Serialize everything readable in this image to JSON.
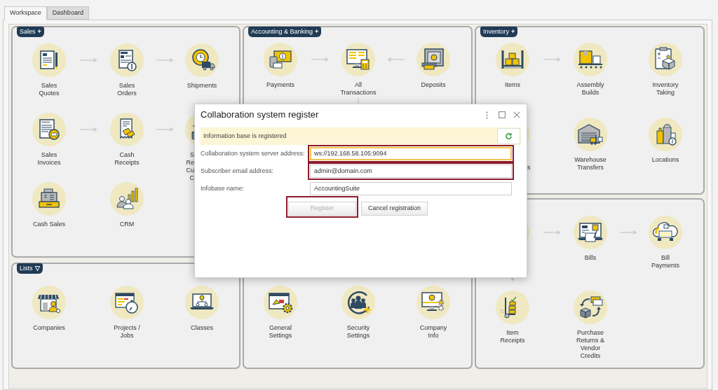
{
  "tabs": [
    {
      "label": "Workspace",
      "selected": true
    },
    {
      "label": "Dashboard",
      "selected": false
    }
  ],
  "columns": [
    {
      "panels": [
        {
          "title": "Sales",
          "toggle": "+",
          "rows": [
            {
              "cells": [
                {
                  "kind": "item",
                  "label": "Sales\nQuotes"
                },
                {
                  "kind": "arrow"
                },
                {
                  "kind": "item",
                  "label": "Sales\nOrders"
                },
                {
                  "kind": "arrow"
                },
                {
                  "kind": "item",
                  "label": "Shipments"
                }
              ]
            },
            {
              "cells": [
                {
                  "kind": "item",
                  "label": "Sales\nInvoices"
                },
                {
                  "kind": "arrow"
                },
                {
                  "kind": "item",
                  "label": "Cash\nReceipts"
                },
                {
                  "kind": "arrow"
                },
                {
                  "kind": "item",
                  "label": "S\nRe\nCu\nC",
                  "covered": true
                }
              ]
            },
            {
              "cells": [
                {
                  "kind": "item",
                  "label": "Cash Sales"
                },
                {
                  "kind": "gap"
                },
                {
                  "kind": "item",
                  "label": "CRM"
                }
              ]
            }
          ]
        },
        {
          "title": "Lists",
          "toggle": "▽",
          "rows": [
            {
              "cells": [
                {
                  "kind": "item",
                  "label": "Companies"
                },
                {
                  "kind": "gap"
                },
                {
                  "kind": "item",
                  "label": "Projects /\nJobs"
                },
                {
                  "kind": "gap"
                },
                {
                  "kind": "item",
                  "label": "Classes"
                }
              ]
            }
          ]
        }
      ]
    },
    {
      "panels": [
        {
          "title": "Accounting & Banking",
          "toggle": "+",
          "rows": [
            {
              "cells": [
                {
                  "kind": "item",
                  "label": "Payments"
                },
                {
                  "kind": "arrow"
                },
                {
                  "kind": "item",
                  "label": "All\nTransactions"
                },
                {
                  "kind": "backarrow"
                },
                {
                  "kind": "item",
                  "label": "Deposits"
                }
              ]
            },
            {
              "cells": [
                {
                  "kind": "gap"
                },
                {
                  "kind": "gap"
                },
                {
                  "kind": "downarrow"
                }
              ]
            }
          ]
        },
        {
          "rows": [
            {
              "cells": [
                {
                  "kind": "item",
                  "label": "General\nSettings"
                },
                {
                  "kind": "gap"
                },
                {
                  "kind": "item",
                  "label": "Security\nSettings"
                },
                {
                  "kind": "gap"
                },
                {
                  "kind": "item",
                  "label": "Company\nInfo"
                }
              ]
            }
          ]
        }
      ]
    },
    {
      "panels": [
        {
          "title": "Inventory",
          "toggle": "+",
          "rows": [
            {
              "cells": [
                {
                  "kind": "item",
                  "label": "Items"
                },
                {
                  "kind": "arrow"
                },
                {
                  "kind": "item",
                  "label": "Assembly\nBuilds"
                },
                {
                  "kind": "gap"
                },
                {
                  "kind": "item",
                  "label": "Inventory\nTaking"
                }
              ]
            },
            {
              "cells": [
                {
                  "kind": "item",
                  "label": "s",
                  "covered": true
                },
                {
                  "kind": "gap"
                },
                {
                  "kind": "item",
                  "label": "Warehouse\nTransfers"
                },
                {
                  "kind": "gap"
                },
                {
                  "kind": "item",
                  "label": "Locations"
                }
              ]
            }
          ]
        },
        {
          "rows": [
            {
              "cells": [
                {
                  "kind": "item",
                  "covered": true
                },
                {
                  "kind": "arrow"
                },
                {
                  "kind": "item",
                  "label": "Bills"
                },
                {
                  "kind": "arrow"
                },
                {
                  "kind": "item",
                  "label": "Bill\nPayments"
                }
              ]
            },
            {
              "cells": [
                {
                  "kind": "downarrow"
                }
              ]
            },
            {
              "cells": [
                {
                  "kind": "item",
                  "label": "Item\nReceipts"
                },
                {
                  "kind": "gap"
                },
                {
                  "kind": "item",
                  "label": "Purchase\nReturns &\nVendor\nCredits"
                }
              ]
            }
          ]
        }
      ]
    }
  ],
  "dialog": {
    "title": "Collaboration system register",
    "status": {
      "message": "Information base is registered"
    },
    "fields": [
      {
        "label": "Collaboration system server address:",
        "value": "ws://192.168.58.105:9094",
        "focused": true,
        "highlighted": true
      },
      {
        "label": "Subscriber email address:",
        "value": "admin@domain.com",
        "focused": false,
        "highlighted": true
      },
      {
        "label": "Infobase name:",
        "value": "AccountingSuite",
        "focused": false,
        "highlighted": false
      }
    ],
    "buttons": [
      {
        "label": "Register",
        "disabled": true,
        "highlighted": true
      },
      {
        "label": "Cancel registration",
        "disabled": false,
        "highlighted": false
      }
    ]
  }
}
